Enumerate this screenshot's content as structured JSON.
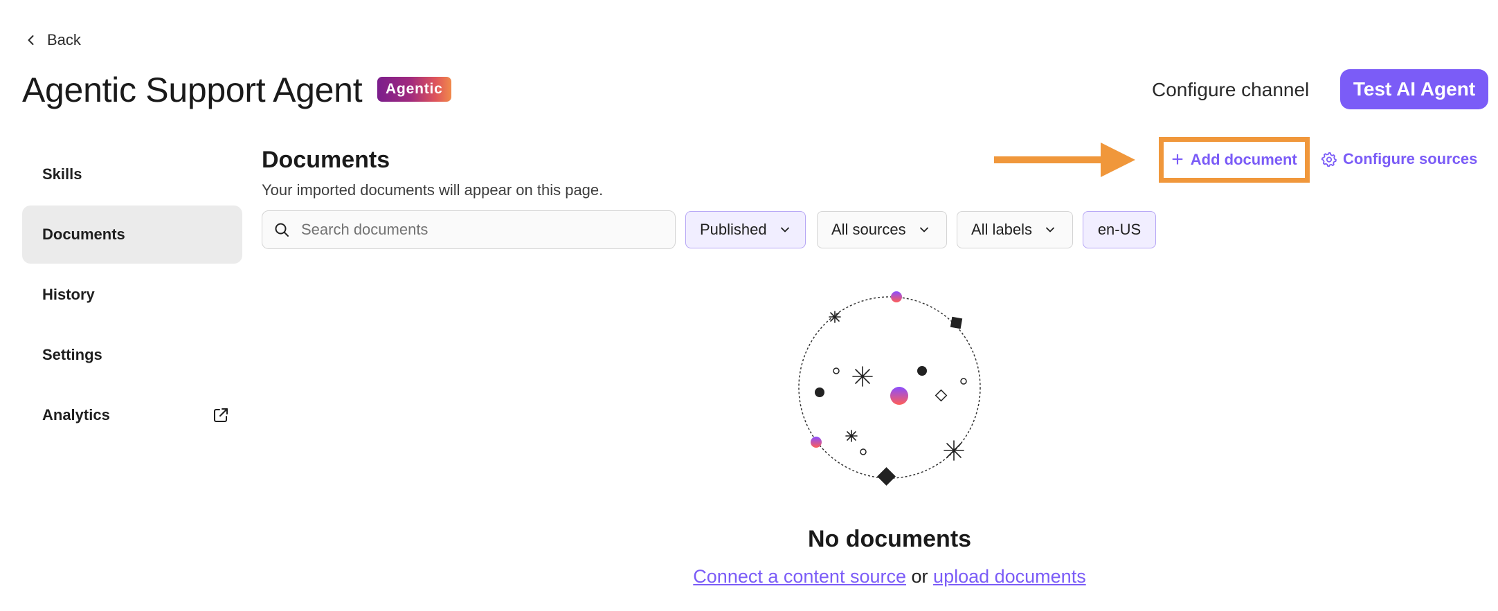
{
  "header": {
    "back_label": "Back",
    "title": "Agentic Support Agent",
    "badge": "Agentic",
    "configure_channel_label": "Configure channel",
    "test_agent_label": "Test AI Agent"
  },
  "sidebar": {
    "items": [
      {
        "label": "Skills",
        "active": false
      },
      {
        "label": "Documents",
        "active": true
      },
      {
        "label": "History",
        "active": false
      },
      {
        "label": "Settings",
        "active": false
      },
      {
        "label": "Analytics",
        "active": false,
        "icon": "external-link-icon"
      }
    ]
  },
  "main": {
    "title": "Documents",
    "subtitle": "Your imported documents will appear on this page.",
    "add_document_label": "Add document",
    "configure_sources_label": "Configure sources",
    "search": {
      "placeholder": "Search documents",
      "value": ""
    },
    "filters": {
      "status": "Published",
      "sources": "All sources",
      "labels": "All labels",
      "language": "en-US"
    },
    "empty": {
      "title": "No documents",
      "link_connect": "Connect a content source",
      "connector": "or",
      "link_upload": "upload documents"
    }
  },
  "colors": {
    "accent": "#7b5cf7",
    "highlight": "#f0973b",
    "active_bg": "#ebebeb"
  }
}
